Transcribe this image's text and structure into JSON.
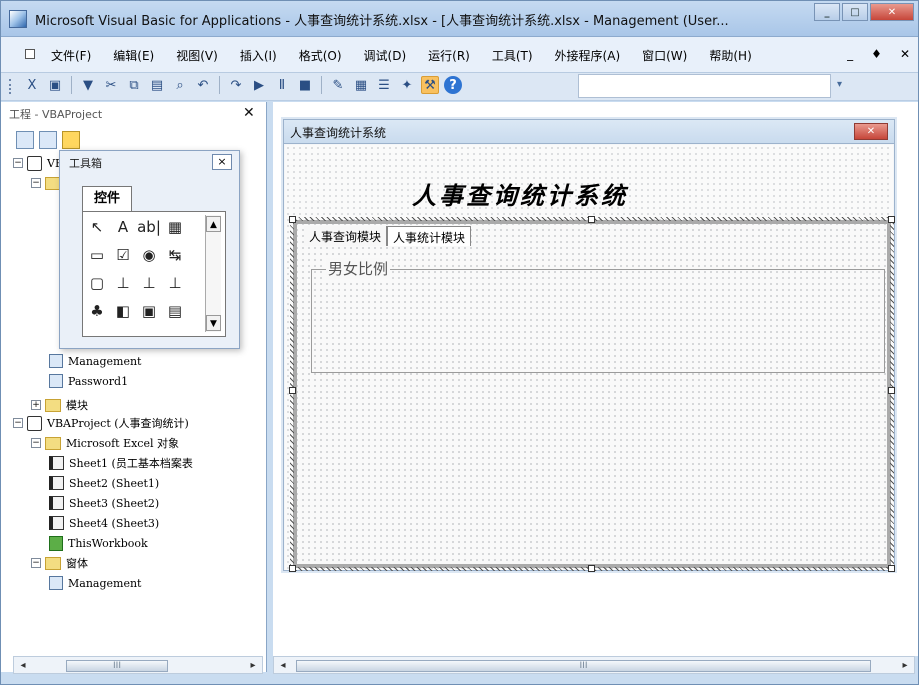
{
  "window": {
    "title": "Microsoft Visual Basic for Applications - 人事查询统计系统.xlsx - [人事查询统计系统.xlsx - Management (User..."
  },
  "menu": {
    "items": [
      "文件(F)",
      "编辑(E)",
      "视图(V)",
      "插入(I)",
      "格式(O)",
      "调试(D)",
      "运行(R)",
      "工具(T)",
      "外接程序(A)",
      "窗口(W)",
      "帮助(H)"
    ],
    "mdi_controls": [
      "_",
      "♦",
      "✕"
    ]
  },
  "toolbar": {
    "icons": [
      "excel-icon",
      "insert-userform-icon",
      "save-icon",
      "cut-icon",
      "copy-icon",
      "paste-icon",
      "find-icon",
      "undo-icon",
      "redo-icon",
      "run-icon",
      "break-icon",
      "reset-icon",
      "design-mode-icon",
      "project-explorer-icon",
      "properties-window-icon",
      "object-browser-icon",
      "toolbox-icon",
      "help-icon"
    ],
    "help_glyph": "?"
  },
  "project_pane": {
    "title": "工程 - VBAProject",
    "close": "✕",
    "tree": [
      {
        "indent": 0,
        "toggle": "−",
        "icon": "vba-project-icon",
        "label": "VBAProject (人事查询统计系统..."
      },
      {
        "indent": 1,
        "toggle": "−",
        "icon": "folder-icon",
        "label": ""
      },
      {
        "indent": 2,
        "toggle": "",
        "icon": "userform-icon",
        "label": "Management"
      },
      {
        "indent": 2,
        "toggle": "",
        "icon": "userform-icon",
        "label": "Password1"
      },
      {
        "indent": 1,
        "toggle": "+",
        "icon": "folder-icon",
        "label": "模块"
      },
      {
        "indent": 0,
        "toggle": "−",
        "icon": "vba-project-icon",
        "label": "VBAProject (人事查询统计)"
      },
      {
        "indent": 1,
        "toggle": "−",
        "icon": "folder-icon",
        "label": "Microsoft Excel 对象"
      },
      {
        "indent": 2,
        "toggle": "",
        "icon": "sheet-icon",
        "label": "Sheet1 (员工基本档案表"
      },
      {
        "indent": 2,
        "toggle": "",
        "icon": "sheet-icon",
        "label": "Sheet2 (Sheet1)"
      },
      {
        "indent": 2,
        "toggle": "",
        "icon": "sheet-icon",
        "label": "Sheet3 (Sheet2)"
      },
      {
        "indent": 2,
        "toggle": "",
        "icon": "sheet-icon",
        "label": "Sheet4 (Sheet3)"
      },
      {
        "indent": 2,
        "toggle": "",
        "icon": "workbook-icon",
        "label": "ThisWorkbook"
      },
      {
        "indent": 1,
        "toggle": "−",
        "icon": "folder-icon",
        "label": "窗体"
      },
      {
        "indent": 2,
        "toggle": "",
        "icon": "userform-icon",
        "label": "Management"
      }
    ],
    "scrollbar_thumb": "III"
  },
  "toolbox": {
    "title": "工具箱",
    "tab": "控件",
    "tools": [
      "↖",
      "A",
      "ab|",
      "▦",
      "▭",
      "☑",
      "◉",
      "↹",
      "▢",
      "⊥",
      "⊥",
      "⊥",
      "♣",
      "◧",
      "▣",
      "▤"
    ],
    "scroll_up": "▲",
    "scroll_down": "▼"
  },
  "userform": {
    "title": "人事查询统计系统",
    "close": "✕",
    "heading": "人事查询统计系统",
    "tabs": [
      "人事查询模块",
      "人事统计模块"
    ],
    "active_tab": 1,
    "frame_caption": "男女比例"
  },
  "right_pane": {
    "scrollbar_thumb": "III"
  }
}
